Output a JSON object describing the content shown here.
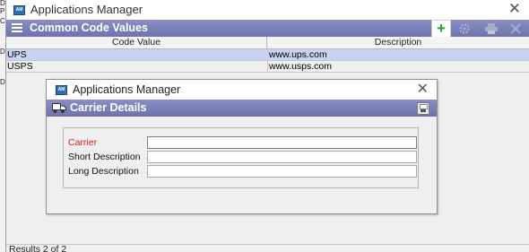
{
  "background_strip": {
    "chars": [
      "D",
      "PE",
      "C",
      "D",
      "DE"
    ]
  },
  "outer_window": {
    "title": "Applications Manager",
    "close_glyph": "✕",
    "panel_title": "Common Code Values",
    "toolbar": {
      "add": "add-icon",
      "settings": "gear-icon",
      "print": "printer-icon",
      "delete": "delete-icon"
    },
    "grid": {
      "columns": [
        "Code Value",
        "Description"
      ],
      "rows": [
        {
          "code": "UPS",
          "description": "www.ups.com",
          "selected": true
        },
        {
          "code": "USPS",
          "description": "www.usps.com",
          "selected": false
        }
      ]
    },
    "footer": "Results 2 of 2"
  },
  "dialog": {
    "title": "Applications Manager",
    "close_glyph": "✕",
    "panel_title": "Carrier Details",
    "fields": {
      "carrier": {
        "label": "Carrier",
        "value": "",
        "required": true
      },
      "short_description": {
        "label": "Short Description",
        "value": ""
      },
      "long_description": {
        "label": "Long Description",
        "value": ""
      }
    }
  },
  "colors": {
    "header_gradient_top": "#8a8ec4",
    "header_gradient_bottom": "#6e73ad",
    "selected_row": "#c9d2f2",
    "required_label": "#d41f1f",
    "add_icon": "#22a02a"
  }
}
